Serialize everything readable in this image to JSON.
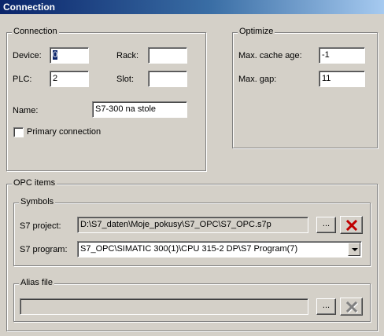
{
  "window": {
    "title": "Connection"
  },
  "connection": {
    "legend": "Connection",
    "device_label": "Device:",
    "device_value": "0",
    "rack_label": "Rack:",
    "rack_value": "",
    "plc_label": "PLC:",
    "plc_value": "2",
    "slot_label": "Slot:",
    "slot_value": "",
    "name_label": "Name:",
    "name_value": "S7-300 na stole",
    "primary_label": "Primary connection",
    "primary_checked": false
  },
  "optimize": {
    "legend": "Optimize",
    "cache_label": "Max. cache age:",
    "cache_value": "-1",
    "gap_label": "Max. gap:",
    "gap_value": "11"
  },
  "opc_items": {
    "legend": "OPC items",
    "symbols": {
      "legend": "Symbols",
      "project_label": "S7 project:",
      "project_value": "D:\\S7_daten\\Moje_pokusy\\S7_OPC\\S7_OPC.s7p",
      "browse_label": "...",
      "program_label": "S7 program:",
      "program_value": "S7_OPC\\SIMATIC 300(1)\\CPU 315-2 DP\\S7 Program(7)"
    },
    "alias": {
      "legend": "Alias file",
      "value": "",
      "browse_label": "..."
    }
  },
  "icons": {
    "remove": "red-x-icon",
    "remove_disabled": "gray-x-icon"
  },
  "colors": {
    "title_start": "#0a246a",
    "title_end": "#a6caf0",
    "delete_red": "#c00000"
  }
}
